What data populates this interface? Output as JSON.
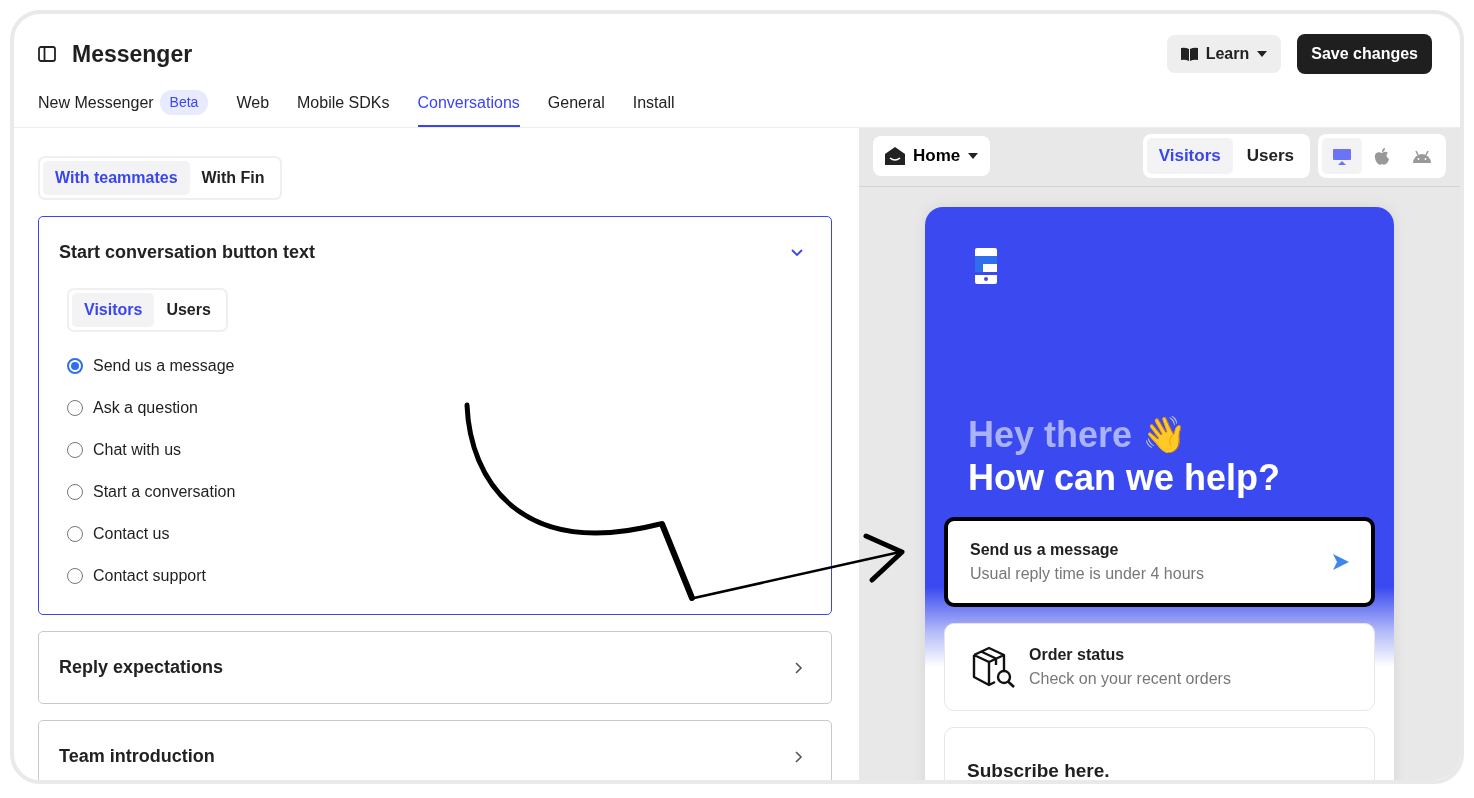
{
  "header": {
    "title": "Messenger",
    "learn_button": "Learn",
    "save_button": "Save changes"
  },
  "tabs": [
    {
      "label": "New Messenger",
      "badge": "Beta",
      "selected": false
    },
    {
      "label": "Web",
      "selected": false
    },
    {
      "label": "Mobile SDKs",
      "selected": false
    },
    {
      "label": "Conversations",
      "selected": true
    },
    {
      "label": "General",
      "selected": false
    },
    {
      "label": "Install",
      "selected": false
    }
  ],
  "mode_toggle": [
    {
      "label": "With teammates",
      "selected": true
    },
    {
      "label": "With Fin",
      "selected": false
    }
  ],
  "sections": [
    {
      "title": "Start conversation button text",
      "expanded": true,
      "audience_toggle": [
        {
          "label": "Visitors",
          "selected": true
        },
        {
          "label": "Users",
          "selected": false
        }
      ],
      "options": [
        {
          "label": "Send us a message",
          "selected": true
        },
        {
          "label": "Ask a question",
          "selected": false
        },
        {
          "label": "Chat with us",
          "selected": false
        },
        {
          "label": "Start a conversation",
          "selected": false
        },
        {
          "label": "Contact us",
          "selected": false
        },
        {
          "label": "Contact support",
          "selected": false
        }
      ]
    },
    {
      "title": "Reply expectations",
      "expanded": false
    },
    {
      "title": "Team introduction",
      "expanded": false
    }
  ],
  "preview": {
    "page_dropdown": "Home",
    "audience": [
      {
        "label": "Visitors",
        "selected": true
      },
      {
        "label": "Users",
        "selected": false
      }
    ],
    "platforms": [
      {
        "kind": "desktop",
        "selected": true
      },
      {
        "kind": "apple",
        "selected": false
      },
      {
        "kind": "android",
        "selected": false
      }
    ],
    "greeting": "Hey there 👋",
    "headline": "How can we help?",
    "cards": [
      {
        "kind": "conversation",
        "title": "Send us a message",
        "subtitle": "Usual reply time is under 4 hours",
        "highlighted": true
      },
      {
        "kind": "app",
        "title": "Order status",
        "subtitle": "Check on your recent orders",
        "highlighted": false
      },
      {
        "kind": "plain",
        "title": "Subscribe here.",
        "highlighted": false
      }
    ]
  }
}
